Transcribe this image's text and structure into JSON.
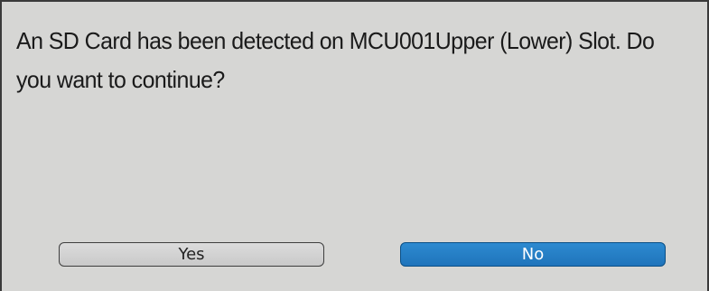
{
  "dialog": {
    "message": "An SD Card has been detected on MCU001Upper (Lower) Slot. Do you want to continue?",
    "buttons": {
      "yes_label": "Yes",
      "no_label": "No"
    },
    "colors": {
      "background": "#d6d6d4",
      "selected_button": "#1f74bb",
      "default_button": "#cfcfcf"
    }
  }
}
